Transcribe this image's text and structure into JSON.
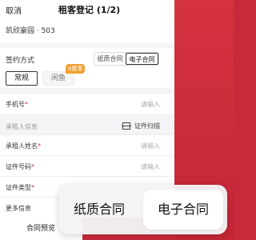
{
  "header": {
    "cancel_label": "取消",
    "title": "租客登记 (1/2)"
  },
  "property": {
    "address": "凯欣豪园 · 503"
  },
  "sign_method": {
    "label": "签约方式",
    "options": [
      "纸质合同",
      "电子合同"
    ],
    "selected": "电子合同"
  },
  "mode": {
    "normal_label": "常规",
    "xianyu_label": "闲鱼",
    "badge": "0费率"
  },
  "fields": {
    "phone_label": "手机号",
    "phone_placeholder": "请输入",
    "tenant_name_label": "承租人姓名",
    "tenant_name_placeholder": "请输入",
    "id_no_label": "证件号码",
    "id_no_placeholder": "请输入",
    "id_type_label": "证件类型",
    "more_label": "更多信息",
    "required_mark": "*"
  },
  "tenant_section": {
    "label": "承租人信息",
    "scan_label": "证件扫描"
  },
  "bottom": {
    "preview_label": "合同预览"
  },
  "popup": {
    "paper_label": "纸质合同",
    "electronic_label": "电子合同"
  },
  "colors": {
    "brand_red": "#c82a3c",
    "badge_orange": "#f0a030"
  }
}
